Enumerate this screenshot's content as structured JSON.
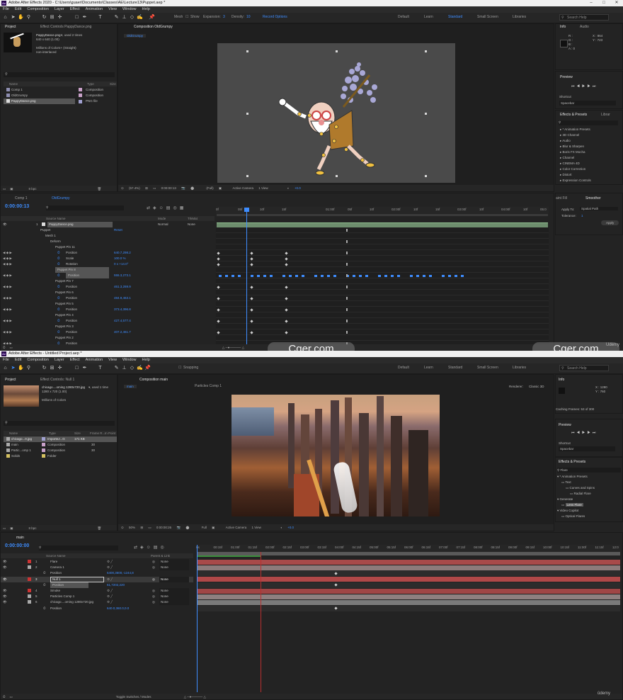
{
  "top": {
    "title": "Adobe After Effects 2020 - C:\\Users\\guaer\\Documents\\Classes\\AE\\Lecture13\\Puppet.aep *",
    "menu": [
      "File",
      "Edit",
      "Composition",
      "Layer",
      "Effect",
      "Animation",
      "View",
      "Window",
      "Help"
    ],
    "toolbar": {
      "mesh": "Mesh",
      "show": "Show",
      "expansion": "Expansion:",
      "expansion_val": "3",
      "density": "Density:",
      "density_val": "10",
      "record": "Record Options"
    },
    "workspaces": [
      "Default",
      "Learn",
      "Standard",
      "Small Screen",
      "Libraries"
    ],
    "active_workspace": "Standard",
    "search": "Search Help",
    "project": {
      "tab": "Project",
      "effect_controls_tab": "Effect Controls PappyDance.png",
      "thumb_name": "PappyDance.png",
      "thumb_used": "▾, used 2 times",
      "thumb_size": "640 x 640 (1.00)",
      "thumb_colors": "Millions of Colors+ (Straight)",
      "thumb_interlace": "non-interlaced",
      "cols": [
        "Name",
        "Type",
        "Size"
      ],
      "items": [
        {
          "name": "Comp 1",
          "type": "Composition",
          "color": "#c9a1c9"
        },
        {
          "name": "OldGrumpy",
          "type": "Composition",
          "color": "#c9a1c9"
        },
        {
          "name": "PappyDance.png",
          "type": "PNG file",
          "color": "#a0a0d0"
        }
      ],
      "bpc": "8 bpc"
    },
    "composition": {
      "tab": "Composition OldGrumpy",
      "sub_tab": "OldGrumpy",
      "zoom": "(57.4%)",
      "time": "0:00:00:13",
      "quality": "(Full)",
      "camera": "Active Camera",
      "views": "1 View",
      "offset": "+0.0"
    },
    "info": {
      "tab": "Info",
      "audio_tab": "Audio",
      "R": "R :",
      "G": "G :",
      "B": "B :",
      "A": "A : 0",
      "X": "X : 864",
      "Y": "Y : 723"
    },
    "preview": {
      "tab": "Preview",
      "shortcut_label": "Shortcut",
      "shortcut": "Spacebar"
    },
    "effects": {
      "tab": "Effects & Presets",
      "libs_tab": "Librar",
      "items": [
        "* Animation Presets",
        "3D Channel",
        "Audio",
        "Blur & Sharpen",
        "Boris FX Mocha",
        "Channel",
        "CINEMA 4D",
        "Color Correction",
        "Distort",
        "Expression Controls"
      ]
    },
    "smoother": {
      "tab": "Smoother",
      "fill_tab": "aint Fill",
      "apply_to_label": "Apply To:",
      "apply_to": "Spatial Path",
      "tolerance_label": "Tolerance:",
      "tolerance": "1",
      "apply": "Apply"
    },
    "timeline": {
      "tabs": [
        "Comp 1",
        "OldGrumpy"
      ],
      "timecode": "0:00:00:13",
      "cols": [
        "Source Name",
        "Mode",
        "TrkMat"
      ],
      "ruler": [
        "0f",
        "05f",
        "10f",
        "15f",
        "20f",
        "01:00f",
        "05f",
        "10f",
        "15f",
        "20f",
        "02:00f",
        "05f",
        "10f",
        "15f",
        "20f",
        "03:00f",
        "05f",
        "10f",
        "15f",
        "20f",
        "04:00f",
        "05f",
        "10f",
        "15f",
        "20f",
        "05:0"
      ],
      "layer": {
        "num": "1",
        "name": "PappyDance.png",
        "mode": "Normal",
        "parent": "None"
      },
      "rows": [
        {
          "label": "Puppet",
          "value": "Reset",
          "indent": 0
        },
        {
          "label": "Mesh 1",
          "value": "",
          "indent": 1
        },
        {
          "label": "Deform",
          "value": "",
          "indent": 2
        },
        {
          "label": "Puppet Pin 11",
          "value": "",
          "indent": 3
        },
        {
          "label": "Position",
          "value": "640.7,298.2",
          "indent": 4
        },
        {
          "label": "Scale",
          "value": "100.0 %",
          "indent": 4
        },
        {
          "label": "Rotation",
          "value": "0 x +14.0°",
          "indent": 4
        },
        {
          "label": "Puppet Pin 8",
          "value": "",
          "indent": 3
        },
        {
          "label": "Position",
          "value": "555.3,273.1",
          "indent": 4
        },
        {
          "label": "Puppet Pin 7",
          "value": "",
          "indent": 3
        },
        {
          "label": "Position",
          "value": "461.3,269.9",
          "indent": 4
        },
        {
          "label": "Puppet Pin 6",
          "value": "",
          "indent": 3
        },
        {
          "label": "Position",
          "value": "484.9,463.1",
          "indent": 4
        },
        {
          "label": "Puppet Pin 5",
          "value": "",
          "indent": 3
        },
        {
          "label": "Position",
          "value": "373.4,396.8",
          "indent": 4
        },
        {
          "label": "Puppet Pin 4",
          "value": "",
          "indent": 3
        },
        {
          "label": "Position",
          "value": "427.4,577.4",
          "indent": 4
        },
        {
          "label": "Puppet Pin 3",
          "value": "",
          "indent": 3
        },
        {
          "label": "Position",
          "value": "407.2,461.7",
          "indent": 4
        },
        {
          "label": "Puppet Pin 2",
          "value": "",
          "indent": 3
        },
        {
          "label": "Position",
          "value": "",
          "indent": 4
        }
      ]
    }
  },
  "bottom": {
    "title": "Adobe After Effects - Untitled Project.aep *",
    "menu": [
      "File",
      "Edit",
      "Composition",
      "Layer",
      "Effect",
      "Animation",
      "View",
      "Window",
      "Help"
    ],
    "snapping": "Snapping",
    "workspaces": [
      "Default",
      "Learn",
      "Standard",
      "Small Screen",
      "Libraries"
    ],
    "search": "Search Help",
    "project": {
      "tab": "Project",
      "effect_controls_tab": "Effect Controls: Null 1",
      "thumb_name": "chicago....oming 1280x720.jpg",
      "thumb_used": "▾, used 1 time",
      "thumb_size": "1280 x 720 (1.00)",
      "thumb_colors": "Millions of Colors",
      "cols": [
        "Name",
        "Type",
        "Size",
        "Frame R...",
        "In Point"
      ],
      "items": [
        {
          "name": "chicago...0.jpg",
          "type": "ImporteJ...G",
          "size": "171 KB",
          "rate": "",
          "color": "#a0a0d0"
        },
        {
          "name": "main",
          "type": "Composition",
          "size": "",
          "rate": "30",
          "color": "#c9a1c9"
        },
        {
          "name": "Partic...omp 1",
          "type": "Composition",
          "size": "",
          "rate": "30",
          "color": "#c9a1c9"
        },
        {
          "name": "Solids",
          "type": "Folder",
          "size": "",
          "rate": "",
          "color": "#d4c060"
        }
      ],
      "bpc": "8 bpc"
    },
    "composition": {
      "tab": "Composition main",
      "layer_tab": "Particles Comp 1",
      "sub_tab": "main",
      "renderer_label": "Renderer:",
      "renderer": "Classic 3D",
      "zoom": "50%",
      "time": "0:00:00:26",
      "quality": "Full",
      "camera": "Active Camera",
      "views": "1 View",
      "offset": "+0.0"
    },
    "info": {
      "tab": "Info",
      "X": "X : 1280",
      "Y": "Y : 760",
      "caching": "Caching Frames: 53 of 300"
    },
    "preview": {
      "tab": "Preview",
      "shortcut_label": "Shortcut",
      "shortcut": "Spacebar"
    },
    "effects": {
      "tab": "Effects & Presets",
      "query": "Flare",
      "items": [
        {
          "label": "* Animation Presets",
          "indent": 0
        },
        {
          "label": "Text",
          "indent": 1
        },
        {
          "label": "Curves and Spins",
          "indent": 2
        },
        {
          "label": "Radial Flare",
          "indent": 3
        },
        {
          "label": "Generate",
          "indent": 0
        },
        {
          "label": "Lens Flare",
          "indent": 1,
          "selected": true
        },
        {
          "label": "Video Copilot",
          "indent": 0
        },
        {
          "label": "Optical Flares",
          "indent": 1
        }
      ]
    },
    "timeline": {
      "tab": "main",
      "timecode": "0:00:00:00",
      "cols": [
        "Source Name",
        "Parent & Link"
      ],
      "ruler": [
        "0s",
        "00:15f",
        "01:00f",
        "01:15f",
        "02:00f",
        "02:15f",
        "03:00f",
        "03:15f",
        "04:00f",
        "04:15f",
        "05:00f",
        "05:15f",
        "06:00f",
        "06:15f",
        "07:00f",
        "07:15f",
        "08:00f",
        "08:15f",
        "09:00f",
        "09:15f",
        "10:00f",
        "10:15f",
        "11:00f",
        "11:15f",
        "12:0"
      ],
      "layers": [
        {
          "num": "1",
          "name": "Flare",
          "color": "#c33",
          "parent": "None",
          "bar": "#a84a4a"
        },
        {
          "num": "2",
          "name": "Camera 1",
          "color": "#aaa",
          "parent": "None",
          "bar": "#8d7b7b"
        },
        {
          "num": "",
          "name": "Position",
          "color": "",
          "parent": "",
          "value": "6400,3600,-1244,8",
          "bar": ""
        },
        {
          "num": "3",
          "name": "Null 1",
          "color": "#c33",
          "parent": "None",
          "bar": "#b04848",
          "selected": true
        },
        {
          "num": "",
          "name": "Position",
          "color": "",
          "parent": "",
          "value": "61,7202,220",
          "bar": ""
        },
        {
          "num": "4",
          "name": "Smoke",
          "color": "#c33",
          "parent": "None",
          "bar": "#a04545"
        },
        {
          "num": "5",
          "name": "Particles Comp 1",
          "color": "#aaa",
          "parent": "None",
          "bar": "#8e7f7f"
        },
        {
          "num": "6",
          "name": "chicago....oming 1280x720.jpg",
          "color": "#aaa",
          "parent": "None",
          "bar": "#7a7a7a"
        },
        {
          "num": "",
          "name": "Position",
          "color": "",
          "parent": "",
          "value": "640.0,360.0,0.0",
          "bar": ""
        }
      ],
      "footer": "Toggle Switches / Modes"
    }
  },
  "watermarks": [
    "Cger.com",
    "Cger.com"
  ],
  "udemy": [
    "Udemy",
    "ûdemy"
  ]
}
